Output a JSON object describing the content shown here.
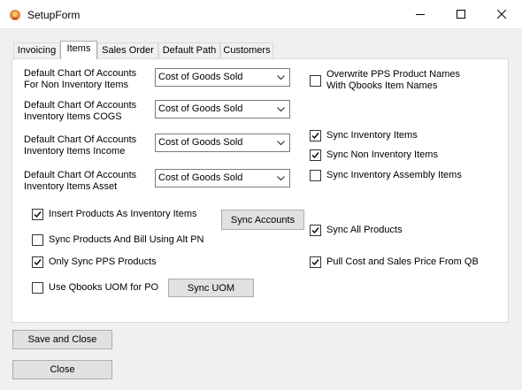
{
  "window": {
    "title": "SetupForm",
    "icon": "app-icon"
  },
  "tabs": [
    {
      "label": "Invoicing",
      "active": false
    },
    {
      "label": "Items",
      "active": true
    },
    {
      "label": "Sales Order",
      "active": false
    },
    {
      "label": "Default Path",
      "active": false
    },
    {
      "label": "Customers",
      "active": false
    }
  ],
  "accounts": [
    {
      "label_line1": "Default Chart Of Accounts",
      "label_line2": "For Non Inventory Items",
      "value": "Cost of Goods Sold"
    },
    {
      "label_line1": "Default Chart Of Accounts",
      "label_line2": "Inventory Items COGS",
      "value": "Cost of Goods Sold"
    },
    {
      "label_line1": "Default Chart Of Accounts",
      "label_line2": "Inventory Items Income",
      "value": "Cost of Goods Sold"
    },
    {
      "label_line1": "Default Chart Of Accounts",
      "label_line2": "Inventory Items Asset",
      "value": "Cost of Goods Sold"
    }
  ],
  "right_options": [
    {
      "label_line1": "Overwrite PPS Product Names",
      "label_line2": "With Qbooks Item Names",
      "checked": false
    },
    {
      "label": "Sync Inventory Items",
      "checked": true
    },
    {
      "label": "Sync Non Inventory Items",
      "checked": true
    },
    {
      "label": "Sync Inventory Assembly Items",
      "checked": false
    },
    {
      "label": "Sync All Products",
      "checked": true
    },
    {
      "label": "Pull Cost and Sales Price From QB",
      "checked": true
    }
  ],
  "left_options": [
    {
      "label": "Insert Products As Inventory Items",
      "checked": true
    },
    {
      "label": "Sync Products And Bill Using Alt PN",
      "checked": false
    },
    {
      "label": "Only Sync PPS Products",
      "checked": true
    },
    {
      "label": "Use Qbooks UOM for PO",
      "checked": false
    }
  ],
  "buttons": {
    "sync_accounts": "Sync Accounts",
    "sync_uom": "Sync UOM",
    "save_close": "Save and Close",
    "close": "Close"
  },
  "colors": {
    "check": "#000000",
    "button_face": "#e1e1e1",
    "border": "#adadad"
  }
}
